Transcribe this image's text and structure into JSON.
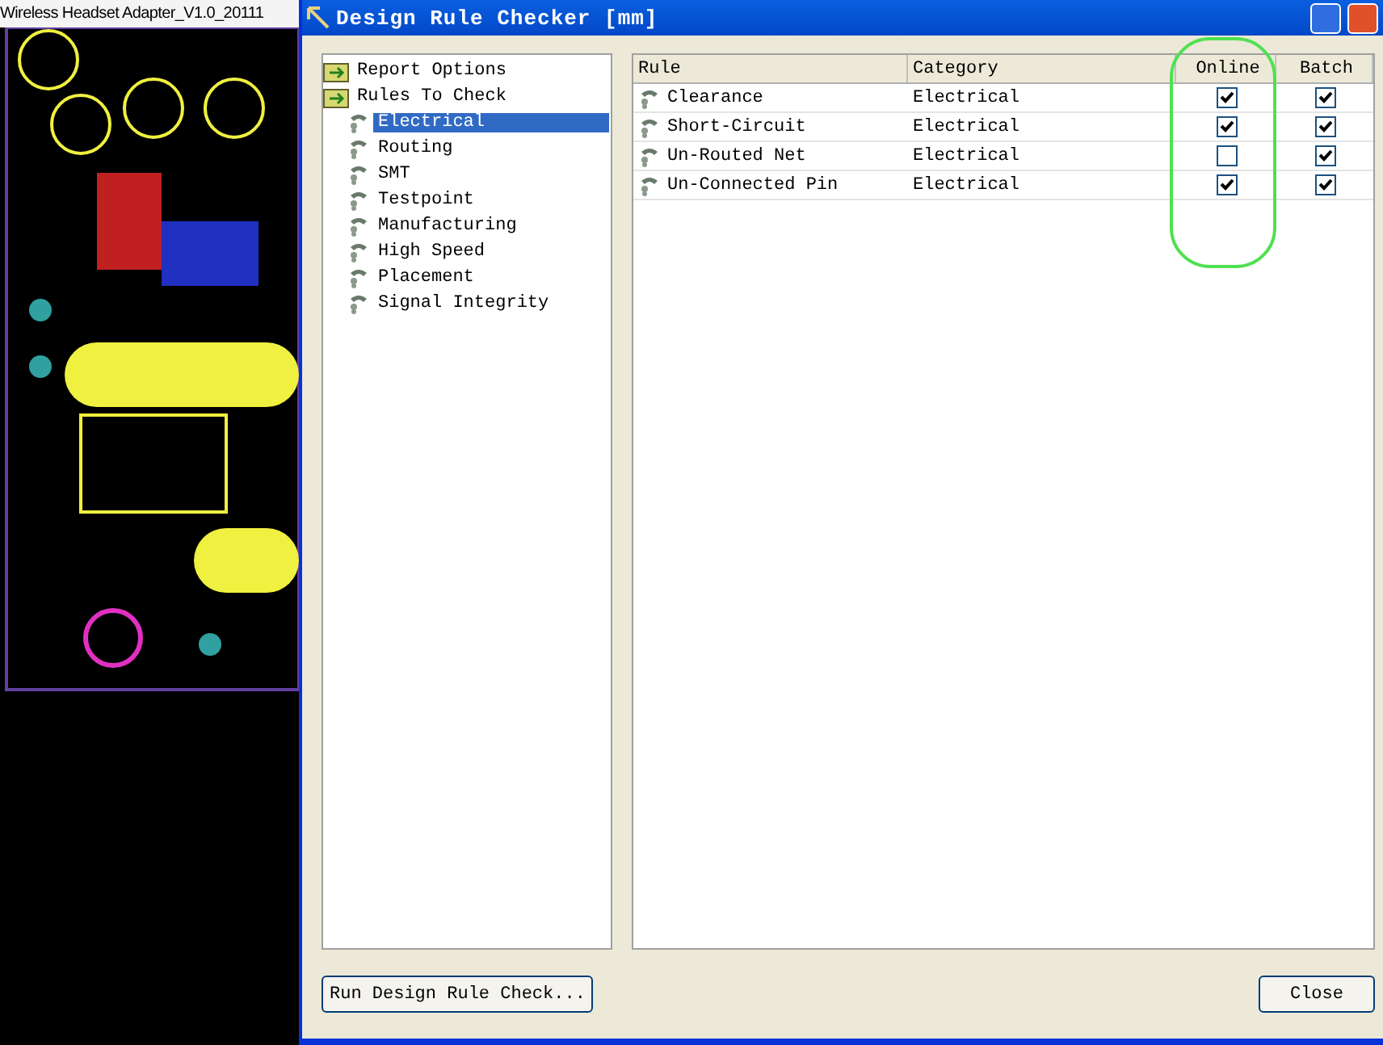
{
  "pcb_window": {
    "title": "Wireless Headset Adapter_V1.0_20111"
  },
  "dialog": {
    "title": "Design Rule Checker [mm]"
  },
  "tree": [
    {
      "label": "Report Options",
      "selected": false
    },
    {
      "label": "Rules To Check",
      "selected": false,
      "children": [
        {
          "label": "Electrical",
          "selected": true
        },
        {
          "label": "Routing",
          "selected": false
        },
        {
          "label": "SMT",
          "selected": false
        },
        {
          "label": "Testpoint",
          "selected": false
        },
        {
          "label": "Manufacturing",
          "selected": false
        },
        {
          "label": "High Speed",
          "selected": false
        },
        {
          "label": "Placement",
          "selected": false
        },
        {
          "label": "Signal Integrity",
          "selected": false
        }
      ]
    }
  ],
  "table": {
    "columns": [
      "Rule",
      "Category",
      "Online",
      "Batch"
    ],
    "rows": [
      {
        "rule": "Clearance",
        "category": "Electrical",
        "online": true,
        "batch": true
      },
      {
        "rule": "Short-Circuit",
        "category": "Electrical",
        "online": true,
        "batch": true
      },
      {
        "rule": "Un-Routed Net",
        "category": "Electrical",
        "online": false,
        "batch": true
      },
      {
        "rule": "Un-Connected Pin",
        "category": "Electrical",
        "online": true,
        "batch": true
      }
    ]
  },
  "buttons": {
    "run": "Run Design Rule Check...",
    "close": "Close"
  }
}
